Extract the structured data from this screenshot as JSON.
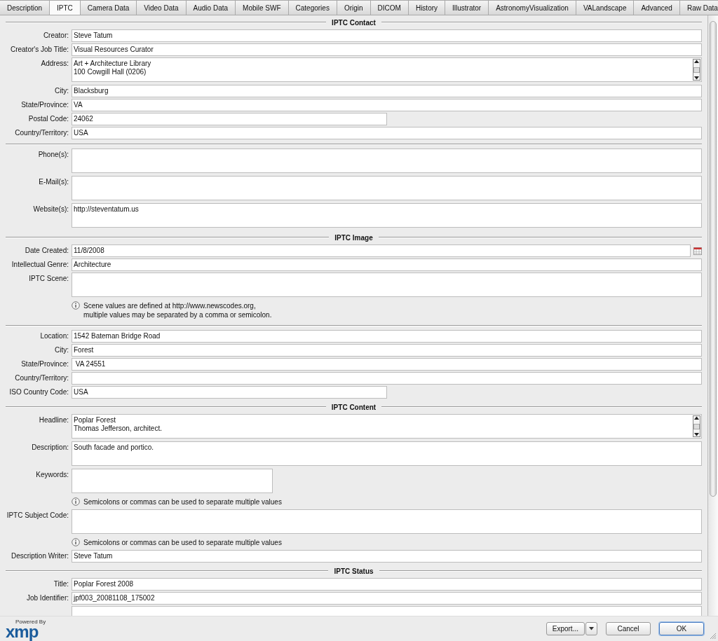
{
  "tabs": [
    {
      "label": "Description",
      "selected": false
    },
    {
      "label": "IPTC",
      "selected": true
    },
    {
      "label": "Camera Data",
      "selected": false
    },
    {
      "label": "Video Data",
      "selected": false
    },
    {
      "label": "Audio Data",
      "selected": false
    },
    {
      "label": "Mobile SWF",
      "selected": false
    },
    {
      "label": "Categories",
      "selected": false
    },
    {
      "label": "Origin",
      "selected": false
    },
    {
      "label": "DICOM",
      "selected": false
    },
    {
      "label": "History",
      "selected": false
    },
    {
      "label": "Illustrator",
      "selected": false
    },
    {
      "label": "AstronomyVisualization",
      "selected": false
    },
    {
      "label": "VALandscape",
      "selected": false
    },
    {
      "label": "Advanced",
      "selected": false
    },
    {
      "label": "Raw Data",
      "selected": false
    }
  ],
  "rows": [
    {
      "kind": "section",
      "title": "IPTC Contact"
    },
    {
      "kind": "field",
      "label": "Creator:",
      "value": "Steve Tatum"
    },
    {
      "kind": "field",
      "label": "Creator's Job Title:",
      "value": "Visual Resources Curator"
    },
    {
      "kind": "box",
      "label": "Address:",
      "value": "Art + Architecture Library\n100 Cowgill Hall (0206)",
      "scrollable": true
    },
    {
      "kind": "field",
      "label": "City:",
      "value": "Blacksburg"
    },
    {
      "kind": "field",
      "label": "State/Province:",
      "value": "VA"
    },
    {
      "kind": "half-field",
      "label": "Postal Code:",
      "value": "24062"
    },
    {
      "kind": "field",
      "label": "Country/Territory:",
      "value": "USA"
    },
    {
      "kind": "divider"
    },
    {
      "kind": "box",
      "label": "Phone(s):"
    },
    {
      "kind": "box",
      "label": "E-Mail(s):"
    },
    {
      "kind": "box",
      "label": "Website(s):",
      "value": "http://steventatum.us"
    },
    {
      "kind": "section",
      "title": "IPTC Image"
    },
    {
      "kind": "field",
      "label": "Date Created:",
      "value": "11/8/2008",
      "date_picker": true
    },
    {
      "kind": "field",
      "label": "Intellectual Genre:",
      "value": "Architecture"
    },
    {
      "kind": "box",
      "label": "IPTC Scene:"
    },
    {
      "kind": "note",
      "text": "Scene values are defined at http://www.newscodes.org,\nmultiple values may be separated by a comma or semicolon."
    },
    {
      "kind": "divider"
    },
    {
      "kind": "field",
      "label": "Location:",
      "value": "1542 Bateman Bridge Road"
    },
    {
      "kind": "field",
      "label": "City:",
      "value": "Forest"
    },
    {
      "kind": "field",
      "label": "State/Province:",
      "value": " VA 24551"
    },
    {
      "kind": "field",
      "label": "Country/Territory:"
    },
    {
      "kind": "half-field",
      "label": "ISO Country Code:",
      "value": "USA"
    },
    {
      "kind": "section",
      "title": "IPTC Content"
    },
    {
      "kind": "box",
      "label": "Headline:",
      "value": "Poplar Forest\nThomas Jefferson, architect.",
      "scrollable": true
    },
    {
      "kind": "box",
      "label": "Description:",
      "value": "South facade and portico."
    },
    {
      "kind": "narrow-box",
      "label": "Keywords:"
    },
    {
      "kind": "note",
      "text": "Semicolons or commas can be used to separate multiple values"
    },
    {
      "kind": "box",
      "label": "IPTC Subject Code:"
    },
    {
      "kind": "note",
      "text": "Semicolons or commas can be used to separate multiple values"
    },
    {
      "kind": "field",
      "label": "Description Writer:",
      "value": "Steve Tatum"
    },
    {
      "kind": "section",
      "title": "IPTC Status"
    },
    {
      "kind": "field",
      "label": "Title:",
      "value": "Poplar Forest 2008"
    },
    {
      "kind": "field",
      "label": "Job Identifier:",
      "value": "jpf003_20081108_175002"
    },
    {
      "kind": "field"
    }
  ],
  "footer": {
    "logo_caption": "Powered By",
    "logo": "xmp",
    "buttons": [
      {
        "label": "Export...",
        "kind": "split",
        "default": false
      },
      {
        "label": "Cancel",
        "kind": "plain",
        "default": false
      },
      {
        "label": "OK",
        "kind": "plain",
        "default": true
      }
    ]
  }
}
